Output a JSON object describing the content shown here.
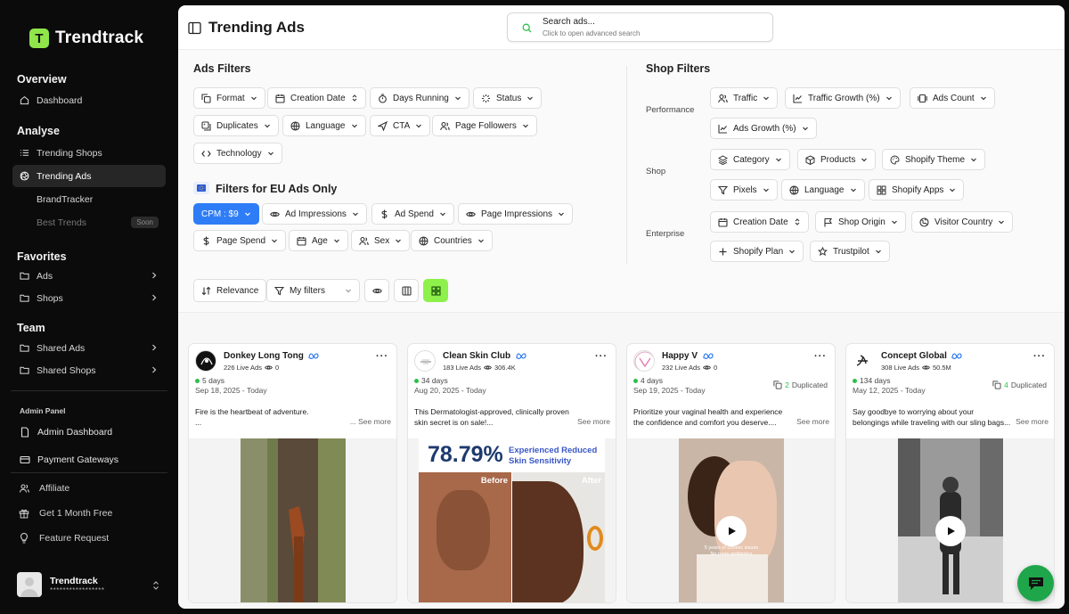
{
  "brand": {
    "name": "Trendtrack",
    "mark": "T",
    "accent": "#8fe54a"
  },
  "sidebar": {
    "overview": {
      "title": "Overview",
      "dashboard": "Dashboard"
    },
    "analyse": {
      "title": "Analyse",
      "items": [
        "Trending Shops",
        "Trending Ads",
        "BrandTracker",
        "Best Trends"
      ],
      "soon": "Soon"
    },
    "favorites": {
      "title": "Favorites",
      "items": [
        "Ads",
        "Shops"
      ]
    },
    "team": {
      "title": "Team",
      "items": [
        "Shared Ads",
        "Shared Shops"
      ]
    },
    "admin": {
      "title": "Admin Panel",
      "items": [
        "Admin Dashboard",
        "Payment Gateways"
      ]
    },
    "extra": [
      "Affiliate",
      "Get 1 Month Free",
      "Feature Request"
    ],
    "user": {
      "name": "Trendtrack",
      "email": "*****************"
    }
  },
  "header": {
    "title": "Trending Ads",
    "search_placeholder": "Search ads...",
    "search_hint": "Click to open advanced search"
  },
  "ads_filters": {
    "title": "Ads Filters",
    "chips": [
      "Format",
      "Creation Date",
      "Days Running",
      "Status",
      "Duplicates",
      "Language",
      "CTA",
      "Page Followers",
      "Technology"
    ],
    "eu_title": "Filters for EU Ads Only",
    "eu_chips": [
      "CPM : $9",
      "Ad Impressions",
      "Ad Spend",
      "Page Impressions",
      "Page Spend",
      "Age",
      "Sex",
      "Countries"
    ]
  },
  "shop_filters": {
    "title": "Shop Filters",
    "performance_label": "Performance",
    "performance": [
      "Traffic",
      "Traffic Growth (%)",
      "Ads Count",
      "Ads Growth (%)"
    ],
    "shop_label": "Shop",
    "shop": [
      "Category",
      "Products",
      "Shopify Theme",
      "Pixels",
      "Language",
      "Shopify Apps"
    ],
    "enterprise_label": "Enterprise",
    "enterprise": [
      "Creation Date",
      "Shop Origin",
      "Visitor Country",
      "Shopify Plan",
      "Trustpilot"
    ]
  },
  "toolbar": {
    "sort": "Relevance",
    "my_filters": "My filters"
  },
  "cards": [
    {
      "name": "Donkey Long Tong",
      "live": "226 Live Ads",
      "views": "0",
      "days": "5 days",
      "date": "Sep 18, 2025 - Today",
      "dup_count": "",
      "dup_label": "",
      "text": "Fire is the heartbeat of adventure.",
      "text2": "...",
      "see_more": "... See more"
    },
    {
      "name": "Clean Skin Club",
      "live": "183 Live Ads",
      "views": "306.4K",
      "days": "34 days",
      "date": "Aug 20, 2025 - Today",
      "dup_count": "",
      "dup_label": "",
      "text": "This Dermatologist-approved, clinically proven",
      "text2": "skin secret is on sale!...",
      "see_more": "See more",
      "media_stat": "78.79%",
      "media_line1": "Experienced Reduced",
      "media_line2": "Skin Sensitivity",
      "before": "Before",
      "after": "After"
    },
    {
      "name": "Happy V",
      "live": "232 Live Ads",
      "views": "0",
      "days": "4 days",
      "date": "Sep 19, 2025 - Today",
      "dup_count": "2",
      "dup_label": "Duplicated",
      "text": "Prioritize your vaginal health and experience",
      "text2": "the confidence and comfort you deserve....",
      "see_more": "See more",
      "caption1": "5 years of chronic issues",
      "caption2": "No more antibiotics"
    },
    {
      "name": "Concept Global",
      "live": "308 Live Ads",
      "views": "50.5M",
      "days": "134 days",
      "date": "May 12, 2025 - Today",
      "dup_count": "4",
      "dup_label": "Duplicated",
      "text": "Say goodbye to worrying about your",
      "text2": "belongings while traveling with our sling bags...",
      "see_more": "See more"
    }
  ]
}
